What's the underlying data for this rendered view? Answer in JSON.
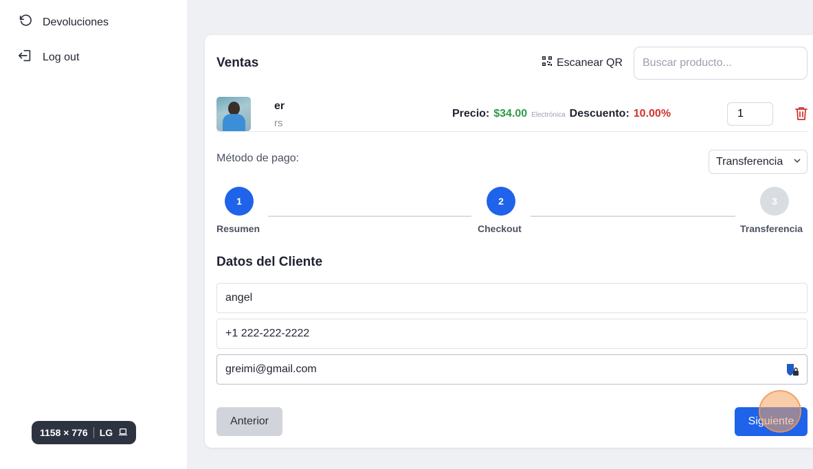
{
  "sidebar": {
    "items": [
      {
        "label": "Devoluciones",
        "icon": "undo-icon"
      },
      {
        "label": "Log out",
        "icon": "logout-icon"
      }
    ]
  },
  "viewport_badge": {
    "size": "1158 × 776",
    "breakpoint": "LG",
    "icon": "laptop-icon"
  },
  "sales": {
    "title": "Ventas",
    "scan_label": "Escanear QR",
    "scan_icon": "qr-icon",
    "search_placeholder": "Buscar producto..."
  },
  "product": {
    "name": "er",
    "subtitle": "rs",
    "price_label": "Precio:",
    "price_value": "$34.00",
    "category": "Electrónica",
    "discount_label": "Descuento:",
    "discount_value": "10.00%",
    "quantity": "1",
    "delete_icon": "trash-icon"
  },
  "payment": {
    "label": "Método de pago:",
    "selected": "Transferencia"
  },
  "stepper": {
    "steps": [
      {
        "number": "1",
        "label": "Resumen",
        "state": "active"
      },
      {
        "number": "2",
        "label": "Checkout",
        "state": "active"
      },
      {
        "number": "3",
        "label": "Transferencia",
        "state": "todo"
      }
    ]
  },
  "client": {
    "section_title": "Datos del Cliente",
    "name": "angel",
    "phone": "+1 222-222-2222",
    "email": "greimi@gmail.com"
  },
  "actions": {
    "prev_label": "Anterior",
    "next_label": "Siguiente"
  },
  "colors": {
    "accent": "#1e63e9",
    "price_green": "#2e9a48",
    "discount_red": "#d0322f"
  }
}
